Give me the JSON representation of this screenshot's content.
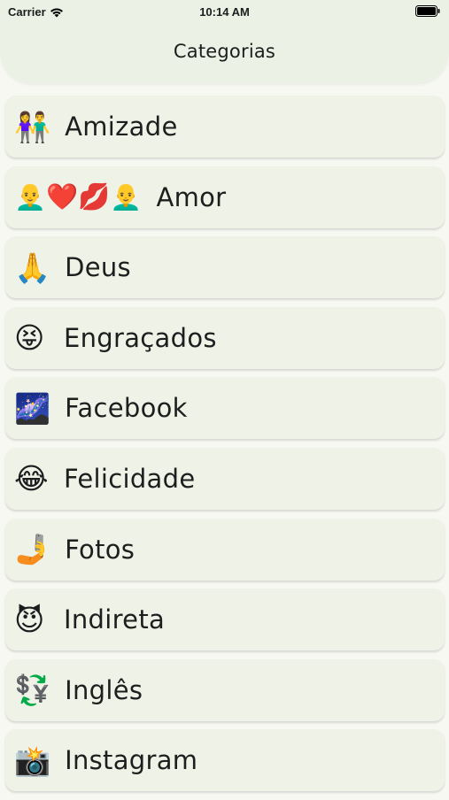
{
  "status_bar": {
    "carrier": "Carrier",
    "time": "10:14 AM"
  },
  "header": {
    "title": "Categorias"
  },
  "categories": [
    {
      "icon": "couple-emoji",
      "emoji": "👫",
      "label": "Amizade"
    },
    {
      "icon": "love-emoji-sequence",
      "emoji": "👨‍🦲❤️💋👨‍🦲",
      "label": "Amor"
    },
    {
      "icon": "praying-hands-emoji",
      "emoji": "🙏",
      "label": "Deus"
    },
    {
      "icon": "squinting-tongue-emoji",
      "emoji": "😝",
      "label": "Engraçados"
    },
    {
      "icon": "night-sky-emoji",
      "emoji": "🌌",
      "label": "Facebook"
    },
    {
      "icon": "tears-of-joy-emoji",
      "emoji": "😂",
      "label": "Felicidade"
    },
    {
      "icon": "selfie-emoji",
      "emoji": "🤳",
      "label": "Fotos"
    },
    {
      "icon": "smiling-devil-emoji",
      "emoji": "😈",
      "label": "Indireta"
    },
    {
      "icon": "currency-exchange-emoji",
      "emoji": "💱",
      "label": "Inglês"
    },
    {
      "icon": "camera-flash-emoji",
      "emoji": "📸",
      "label": "Instagram"
    }
  ],
  "colors": {
    "background": "#f7f8f2",
    "header": "#ebf1e4",
    "card": "#eef2e7"
  }
}
